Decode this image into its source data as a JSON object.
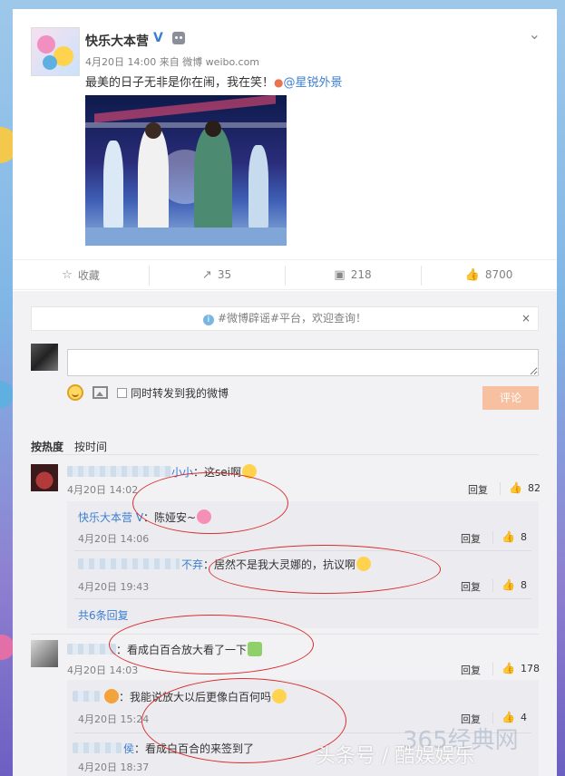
{
  "post": {
    "username": "快乐大本营",
    "verified_badge": "V",
    "time_source": "4月20日 14:00 来自 微博 weibo.com",
    "text": "最美的日子无非是你在闹，我在笑！",
    "location_tag": "@星锐外景"
  },
  "actions": {
    "favorite_label": "收藏",
    "repost_count": "35",
    "comment_count": "218",
    "like_count": "8700"
  },
  "notice": {
    "text": "#微博辟谣#平台，欢迎查询！",
    "close": "×"
  },
  "compose": {
    "input_placeholder": "",
    "repost_label": "同时转发到我的微博",
    "submit_label": "评论"
  },
  "sort": {
    "hot": "按热度",
    "time": "按时间"
  },
  "comments": [
    {
      "name_visible": "小小",
      "text": "：这sei啊",
      "date": "4月20日 14:02",
      "reply": "回复",
      "likes": "82",
      "replies": [
        {
          "name": "快乐大本营",
          "text": "：陈娅安~",
          "date": "4月20日 14:06",
          "reply": "回复",
          "likes": "8"
        },
        {
          "name_visible": "不弃",
          "text": "：居然不是我大灵娜的，抗议啊",
          "date": "4月20日 19:43",
          "reply": "回复",
          "likes": "8"
        }
      ],
      "more": "共6条回复"
    },
    {
      "text": "：看成白百合放大看了一下",
      "date": "4月20日 14:03",
      "reply": "回复",
      "likes": "178",
      "replies": [
        {
          "text": "：我能说放大以后更像白百何吗",
          "date": "4月20日 15:24",
          "reply": "回复",
          "likes": "4"
        },
        {
          "name_visible": "侯",
          "text": "：看成白百合的来签到了",
          "date": "4月20日 18:37"
        }
      ]
    }
  ],
  "watermark": {
    "text": "头条号 / 酷娱娱乐",
    "faint": "365经典网"
  },
  "colors": {
    "link": "#3b7ed0",
    "accent": "#eb7350",
    "annotation": "#d82e2e"
  },
  "icons": [
    "chevron-down-icon",
    "star-icon",
    "share-icon",
    "comment-icon",
    "thumb-up-icon",
    "info-icon",
    "emoji-icon",
    "image-icon"
  ]
}
